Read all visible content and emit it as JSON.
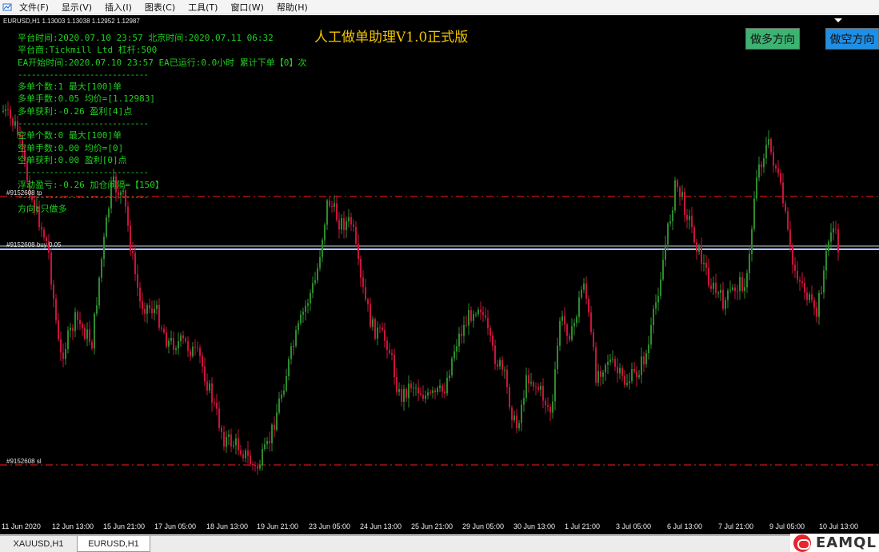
{
  "menu": {
    "items": [
      "文件(F)",
      "显示(V)",
      "插入(I)",
      "图表(C)",
      "工具(T)",
      "窗口(W)",
      "帮助(H)"
    ]
  },
  "chart": {
    "symbol_info": "EURUSD,H1  1.13003 1.13038 1.12952 1.12987",
    "ea_title": "人工做单助理V1.0正式版",
    "buttons": {
      "long": "做多方向",
      "short": "做空方向"
    },
    "info_lines": [
      "平台时间:2020.07.10 23:57 北京时间:2020.07.11 06:32",
      "平台商:Tickmill Ltd 杠杆:500",
      "EA开始时间:2020.07.10 23:57 EA已运行:0.0小时 累计下单【0】次",
      "-----------------------------",
      "多单个数:1 最大[100]单",
      "多单手数:0.05 均价=[1.12983]",
      "多单获利:-0.26 盈利[4]点",
      "-----------------------------",
      "空单个数:0 最大[100]单",
      "空单手数:0.00 均价=[0]",
      "空单获利:0.00 盈利[0]点",
      "-----------------------------",
      "浮动盈亏:-0.26 加仓间隔=【150】",
      "-----------------------------",
      "方向:只做多"
    ],
    "lines": {
      "tp_label": "#9152608 tp",
      "buy_label": "#9152608 buy 0.05",
      "sl_label": "#9152608 sl"
    },
    "time_labels": [
      "11 Jun 2020",
      "12 Jun 13:00",
      "15 Jun 21:00",
      "17 Jun 05:00",
      "18 Jun 13:00",
      "19 Jun 21:00",
      "23 Jun 05:00",
      "24 Jun 13:00",
      "25 Jun 21:00",
      "29 Jun 05:00",
      "30 Jun 13:00",
      "1 Jul 21:00",
      "3 Jul 05:00",
      "6 Jul 13:00",
      "7 Jul 21:00",
      "9 Jul 05:00",
      "10 Jul 13:00"
    ],
    "colors": {
      "background": "#000000",
      "bull": "#2e8b2e",
      "bear": "#c8143c",
      "info_text": "#1fd11f",
      "title": "#f0c400",
      "tp_sl_line": "#d21414",
      "buy_line": "#a8c8ff"
    }
  },
  "tabs": [
    "XAUUSD,H1",
    "EURUSD,H1"
  ],
  "watermark": {
    "text": "EAMQL"
  },
  "icons": {
    "app": "mt4-app-icon",
    "watermark": "eamql-logo-icon"
  }
}
